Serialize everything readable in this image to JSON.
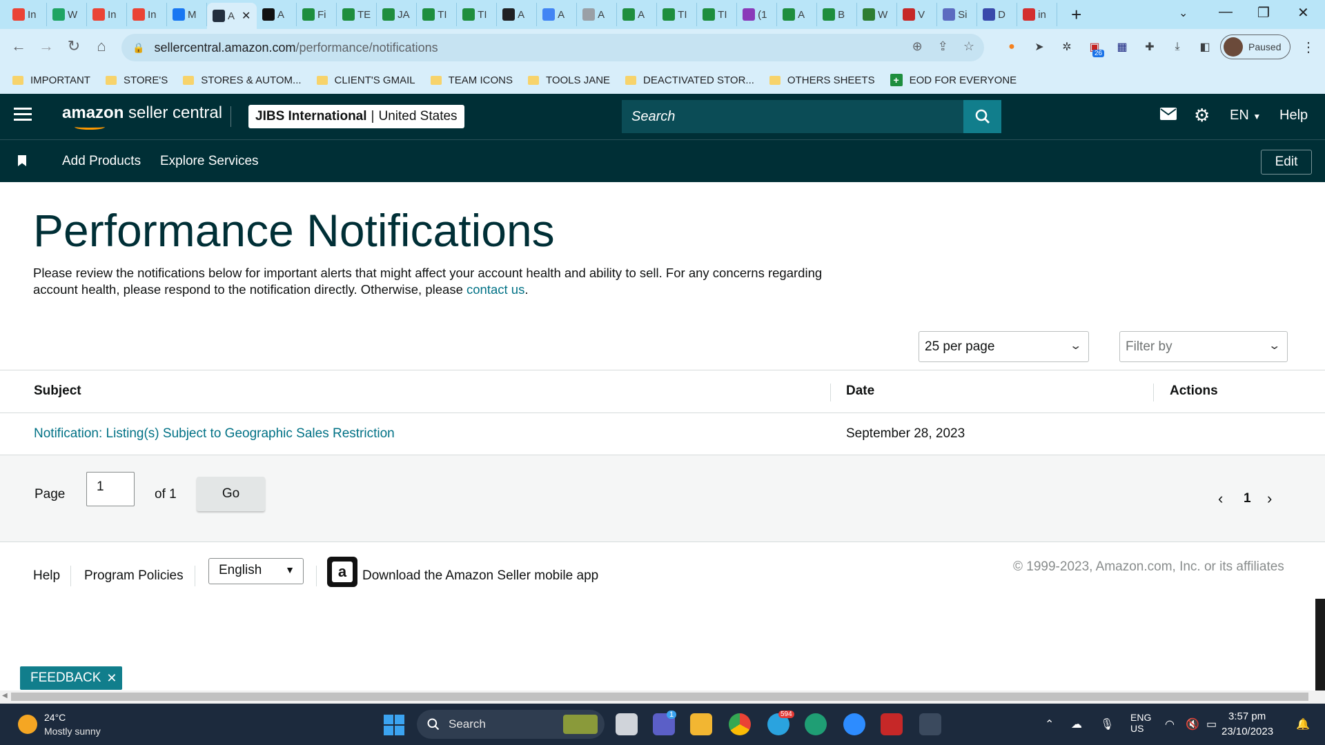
{
  "browser": {
    "tabs": [
      {
        "icon": "gmail-icon",
        "label": "In",
        "color": "#ea4335"
      },
      {
        "icon": "google-drive-icon",
        "label": "W",
        "color": "#1fa463"
      },
      {
        "icon": "gmail-icon",
        "label": "In",
        "color": "#ea4335"
      },
      {
        "icon": "gmail-icon",
        "label": "In",
        "color": "#ea4335"
      },
      {
        "icon": "facebook-icon",
        "label": "M",
        "color": "#1877f2"
      },
      {
        "icon": "amazon-icon",
        "label": "A",
        "color": "#232f3e"
      },
      {
        "icon": "amazon-a-icon",
        "label": "A",
        "color": "#111111"
      },
      {
        "icon": "sheets-icon",
        "label": "Fi",
        "color": "#1e8e3e"
      },
      {
        "icon": "sheets-icon",
        "label": "TE",
        "color": "#1e8e3e"
      },
      {
        "icon": "sheets-icon",
        "label": "JA",
        "color": "#1e8e3e"
      },
      {
        "icon": "sheets-icon",
        "label": "TI",
        "color": "#1e8e3e"
      },
      {
        "icon": "sheets-icon",
        "label": "TI",
        "color": "#1e8e3e"
      },
      {
        "icon": "circle-c-icon",
        "label": "A",
        "color": "#202124"
      },
      {
        "icon": "pencil-icon",
        "label": "A",
        "color": "#4285f4"
      },
      {
        "icon": "globe-icon",
        "label": "A",
        "color": "#9aa0a6"
      },
      {
        "icon": "sheets-icon",
        "label": "A",
        "color": "#1e8e3e"
      },
      {
        "icon": "sheets-icon",
        "label": "TI",
        "color": "#1e8e3e"
      },
      {
        "icon": "sheets-icon",
        "label": "TI",
        "color": "#1e8e3e"
      },
      {
        "icon": "messenger-icon",
        "label": "(1",
        "color": "#8a3ab9"
      },
      {
        "icon": "sheets-icon",
        "label": "A",
        "color": "#1e8e3e"
      },
      {
        "icon": "sheets-icon",
        "label": "B",
        "color": "#1e8e3e"
      },
      {
        "icon": "w-logo-icon",
        "label": "W",
        "color": "#2e7d32"
      },
      {
        "icon": "w-red-icon",
        "label": "V",
        "color": "#c62828"
      },
      {
        "icon": "cloud-icon",
        "label": "Si",
        "color": "#5c6bc0"
      },
      {
        "icon": "bird-icon",
        "label": "D",
        "color": "#3949ab"
      },
      {
        "icon": "triangle-icon",
        "label": "in",
        "color": "#d32f2f"
      }
    ],
    "url_host": "sellercentral.amazon.com",
    "url_path": "/performance/notifications",
    "profile_label": "Paused",
    "extension_badge": "26",
    "bookmarks": [
      {
        "label": "IMPORTANT",
        "type": "folder"
      },
      {
        "label": "STORE'S",
        "type": "folder"
      },
      {
        "label": "STORES & AUTOM...",
        "type": "folder"
      },
      {
        "label": "CLIENT'S GMAIL",
        "type": "folder"
      },
      {
        "label": "TEAM ICONS",
        "type": "folder"
      },
      {
        "label": "TOOLS JANE",
        "type": "folder"
      },
      {
        "label": "DEACTIVATED STOR...",
        "type": "folder"
      },
      {
        "label": "OTHERS SHEETS",
        "type": "folder"
      },
      {
        "label": "EOD FOR EVERYONE",
        "type": "sheet"
      }
    ]
  },
  "header": {
    "brand_bold": "amazon",
    "brand_rest": " seller central",
    "account_name": "JIBS International",
    "account_sep": "|",
    "account_region": "United States",
    "search_placeholder": "Search",
    "language": "EN",
    "help": "Help",
    "edit": "Edit",
    "nav": [
      "Add Products",
      "Explore Services"
    ]
  },
  "main": {
    "title": "Performance Notifications",
    "description_line1": "Please review the notifications below for important alerts that might affect your account health and ability to sell. For any concerns regarding",
    "description_line2": "account health, please respond to the notification directly. Otherwise, please ",
    "contact_link": "contact us",
    "description_end": ".",
    "per_page": "25 per page",
    "filter_placeholder": "Filter by",
    "columns": {
      "subject": "Subject",
      "date": "Date",
      "actions": "Actions"
    },
    "rows": [
      {
        "subject": "Notification: Listing(s) Subject to Geographic Sales Restriction",
        "date": "September 28, 2023"
      }
    ],
    "pager": {
      "page_label": "Page",
      "current": "1",
      "of_label": "of 1",
      "go": "Go",
      "nav_current": "1"
    }
  },
  "footer": {
    "help": "Help",
    "policies": "Program Policies",
    "language": "English",
    "app_text": "Download the Amazon Seller mobile app",
    "copyright": "© 1999-2023, Amazon.com, Inc. or its affiliates",
    "feedback": "FEEDBACK"
  },
  "taskbar": {
    "temperature": "24°C",
    "weather": "Mostly sunny",
    "search": "Search",
    "telegram_badge": "594",
    "teams_badge": "1",
    "lang_line1": "ENG",
    "lang_line2": "US",
    "time": "3:57 pm",
    "date": "23/10/2023"
  },
  "colors": {
    "header_bg": "#002f36",
    "link": "#007185",
    "accent_teal": "#117e8c",
    "tabstrip": "#b9e5f8"
  }
}
